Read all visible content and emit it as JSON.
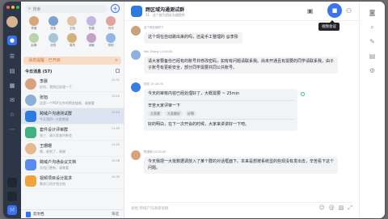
{
  "rail": {
    "icons": [
      "chat-bubble-icon",
      "contacts-icon",
      "docs-icon",
      "calendar-icon",
      "mail-icon",
      "star-icon",
      "more-icon"
    ]
  },
  "list": {
    "search_placeholder": "搜索",
    "contacts": [
      {
        "name": "李薇",
        "color": "#d7a679"
      },
      {
        "name": "张浩",
        "color": "#7aa3d4"
      },
      {
        "name": "王晓",
        "color": "#e0c3a4"
      },
      {
        "name": "陈晨",
        "color": "#c6b5e0"
      },
      {
        "name": "刘洋",
        "color": "#e2a2a2"
      },
      {
        "name": "赵琳",
        "color": "#b9d4a8"
      },
      {
        "name": "孙悦",
        "color": "#a7c7d8"
      },
      {
        "name": "周杰",
        "color": "#d4b07a"
      },
      {
        "name": "吴敏",
        "color": "#c5a1c9"
      },
      {
        "name": "郑阳",
        "color": "#93b6e6"
      }
    ],
    "banner": "消息提醒 · 已开启",
    "section_title": "今日消息 (57)",
    "rows": [
      {
        "title": "李晨",
        "sub": "好的，我稍后处理一下",
        "time": "12:31",
        "color": "#d9a07d"
      },
      {
        "title": "张旭",
        "sub": "这是一个PDF文件的预览链接，请查看",
        "time": "12:20",
        "color": "#8ab0da"
      },
      {
        "title": "跨域户沟通测试群",
        "sub": "今天我把一大批数据",
        "time": "12:10",
        "color": "#2b7be0"
      },
      {
        "title": "套件设计评审群",
        "sub": "张三：请大家准时参会",
        "time": "11:45",
        "color": "#3fb27f"
      },
      {
        "title": "王珊珊",
        "sub": "嗯，收到了，谢谢",
        "time": "11:20",
        "color": "#e3b98d"
      },
      {
        "title": "跨域户沟通会议文档",
        "sub": "文档已更新，请查看",
        "time": "10:58",
        "color": "#5b8cf0"
      },
      {
        "title": "视频项目设计需求",
        "sub": "需求已同步到文档",
        "time": "10:30",
        "color": "#f0a23b"
      }
    ],
    "footer": "云文档",
    "footer_filter": "筛选"
  },
  "chat": {
    "group_name": "跨区域沟通测试群",
    "group_info": "31 · 这个群为团队沟通提供",
    "tooltip": "视频会议",
    "messages": [
      {
        "who": "这个现在就好了",
        "text": "这个现在自动跳出来的吗，还是手工整理的 @李彤",
        "color": "#caa27e"
      },
      {
        "who": "Min Zhang  12:00:00",
        "text": "请大家要备份已经有的账号并修改密码，如有有问题请联系我。尚未开通且有需要的同学请联系我，由子子账号有更新安全，部分同学需要共同公共账号。",
        "color": "#8fb1de"
      },
      {
        "who": "张宏  15:20:00",
        "text": "今天的审核内容已经处理好了，大概需要 ~ 25min",
        "sub": "辛苦大家评审一下",
        "reacts": [
          "大家都",
          "大家都好",
          "好啊"
        ],
        "tail": "好的明白，在下一次开会的时候，大家来讲讲好一下吧。",
        "color": "#3a7de0"
      },
      {
        "who": "陈国明  15:20:00",
        "text": "今天我把一大批数据调放入了某个群的对话框面下。本来是想按系统显的些现没有发出去，辛苦看下这个问题。",
        "color": "#d6a27f"
      }
    ],
    "input_placeholder": "发给 跨域户沟通测试群"
  }
}
